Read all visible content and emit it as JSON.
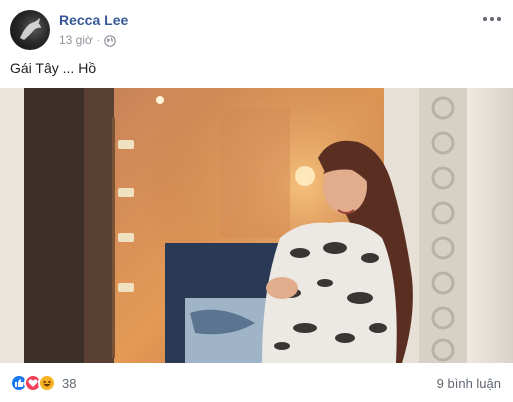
{
  "post": {
    "author": "Recca Lee",
    "time": "13 giờ",
    "separator": "·",
    "privacy_icon": "globe-icon",
    "caption": "Gái Tây ... Hồ",
    "photo_desc_icon": "post-photo"
  },
  "footer": {
    "reaction_icons": [
      "like-icon",
      "love-icon",
      "haha-icon"
    ],
    "reaction_count": "38",
    "comments": "9 bình luận"
  },
  "colors": {
    "author": "#385898",
    "meta": "#90949c",
    "like": "#1877f2",
    "love": "#f33e58",
    "haha": "#f7b125"
  }
}
